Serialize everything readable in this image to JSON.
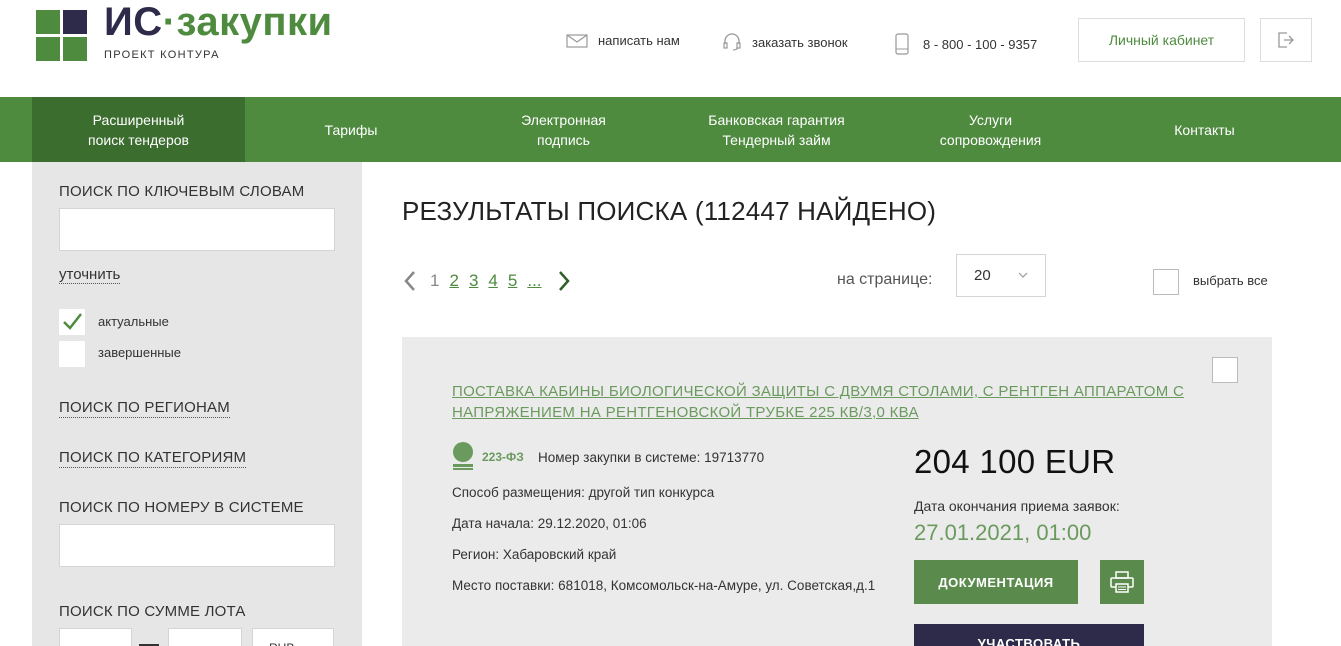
{
  "header": {
    "logo_part1": "ИС",
    "logo_dot": "·",
    "logo_part2": "закупки",
    "logo_subtitle": "ПРОЕКТ КОНТУРА",
    "write_us": "написать нам",
    "order_call": "заказать звонок",
    "phone": "8 - 800 - 100 - 9357",
    "cabinet": "Личный кабинет",
    "brand_green": "#4e8b3f",
    "brand_dark": "#2d2a4a"
  },
  "nav": {
    "items": [
      {
        "line1": "Расширенный",
        "line2": "поиск тендеров"
      },
      {
        "line1": "Тарифы",
        "line2": ""
      },
      {
        "line1": "Электронная",
        "line2": "подпись"
      },
      {
        "line1": "Банковская гарантия",
        "line2": "Тендерный займ"
      },
      {
        "line1": "Услуги",
        "line2": "сопровождения"
      },
      {
        "line1": "Контакты",
        "line2": ""
      }
    ]
  },
  "sidebar": {
    "keyword_label": "ПОИСК ПО КЛЮЧЕВЫМ СЛОВАМ",
    "keyword_value": "",
    "refine": "уточнить",
    "status_actual": "актуальные",
    "status_actual_checked": true,
    "status_finished": "завершенные",
    "status_finished_checked": false,
    "regions": "ПОИСК ПО РЕГИОНАМ",
    "categories": "ПОИСК ПО КАТЕГОРИЯМ",
    "number_label": "ПОИСК ПО НОМЕРУ В СИСТЕМЕ",
    "number_value": "",
    "sum_label": "ПОИСК ПО СУММЕ ЛОТА",
    "sum_currency": "RUB"
  },
  "results": {
    "title": "РЕЗУЛЬТАТЫ ПОИСКА (112447 НАЙДЕНО)",
    "pages": [
      "1",
      "2",
      "3",
      "4",
      "5",
      "..."
    ],
    "current_page": "1",
    "per_page_label": "на странице:",
    "per_page_value": "20",
    "select_all": "выбрать все"
  },
  "card": {
    "title": "ПОСТАВКА КАБИНЫ БИОЛОГИЧЕСКОЙ ЗАЩИТЫ С ДВУМЯ СТОЛАМИ, С РЕНТГЕН АППАРАТОМ С НАПРЯЖЕНИЕМ НА РЕНТГЕНОВСКОЙ ТРУБКЕ 225 КВ/3,0 КВА",
    "law": "223-ФЗ",
    "number": "Номер закупки в системе: 19713770",
    "method": "Способ размещения: другой тип конкурса",
    "start": "Дата начала: 29.12.2020, 01:06",
    "region": "Регион: Хабаровский край",
    "place": "Место поставки: 681018, Комсомольск-на-Амуре, ул. Советская,д.1",
    "price": "204 100 EUR",
    "deadline_label": "Дата окончания приема заявок:",
    "deadline_value": "27.01.2021, 01:00",
    "doc_button": "ДОКУМЕНТАЦИЯ",
    "join_button": "УЧАСТВОВАТЬ"
  }
}
